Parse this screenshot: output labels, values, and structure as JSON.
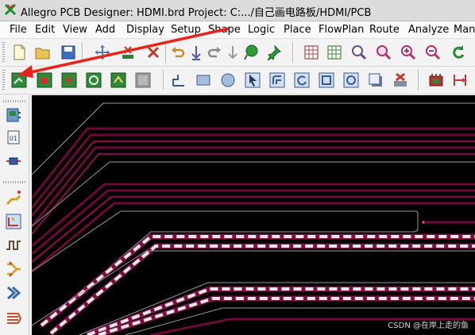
{
  "window": {
    "title": "Allegro PCB Designer: HDMI.brd  Project: C:.../自己画电路板/HDMI/PCB"
  },
  "menu": [
    "File",
    "Edit",
    "View",
    "Add",
    "Display",
    "Setup",
    "Shape",
    "Logic",
    "Place",
    "FlowPlan",
    "Route",
    "Analyze",
    "Manu"
  ],
  "toolbar_top": {
    "icons": [
      "new-file-icon",
      "open-folder-icon",
      "save-icon",
      "move-icon",
      "copy-icon",
      "delete-icon",
      "undo-icon",
      "redo-up-icon",
      "redo-icon",
      "done-icon",
      "pick-icon",
      "pin-icon",
      "grid-icon",
      "ratsnest-icon",
      "zoom-fit-icon",
      "zoom-prev-icon",
      "zoom-in-icon",
      "zoom-out-icon",
      "refresh-icon"
    ]
  },
  "toolbar_shape": {
    "icons": [
      "shape-edit-icon",
      "shape-select-icon",
      "shape-merge-icon",
      "shape-void-icon",
      "shape-update-icon",
      "shape-blank-icon",
      "add-line-icon",
      "add-rect-icon",
      "add-circle-icon",
      "pick-select-icon",
      "add-arc-icon",
      "rotate-icon",
      "rect-outline-icon",
      "circle-outline-icon",
      "shadow-icon",
      "delete-element-icon",
      "component-icon",
      "dimension-icon"
    ]
  },
  "leftbar": {
    "icons": [
      "place-component-icon",
      "ic-u1-icon",
      "resistor-icon",
      "route-icon",
      "tune-icon",
      "pulse-icon",
      "fanout-icon",
      "chevron-icon",
      "bus-icon"
    ]
  },
  "watermark": "CSDN @在岸上走的鱼",
  "colors": {
    "canvas_bg": "#000000",
    "trace": "#6b0a39",
    "trace_light": "#a0205a",
    "dash": "#e8e8e8",
    "outline": "#9a9a9a",
    "arrow": "#e8231c"
  }
}
